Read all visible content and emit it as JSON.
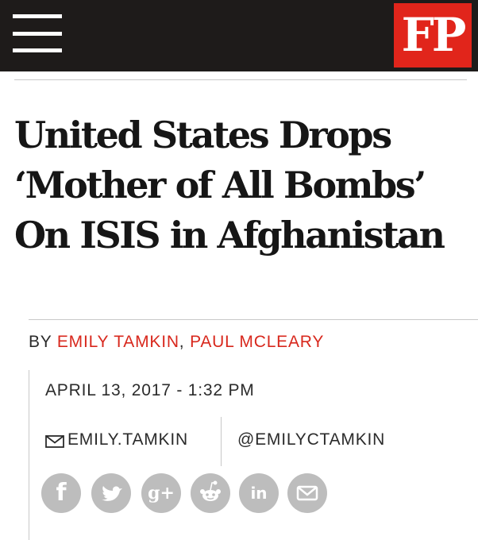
{
  "header": {
    "menu_icon": "hamburger-menu-icon",
    "logo_text": "FP",
    "brand_color": "#e1251b",
    "bar_color": "#1e1b1a"
  },
  "article": {
    "title": "United States Drops ‘Mother of All Bombs’ On ISIS in Afghanistan",
    "byline_prefix": "BY",
    "authors": [
      "EMILY TAMKIN",
      "PAUL MCLEARY"
    ],
    "author_separator": ",",
    "author_color": "#d8281d",
    "date": "APRIL 13, 2017 - 1:32 PM"
  },
  "contact": {
    "email_icon": "envelope-icon",
    "email_label": "EMILY.TAMKIN",
    "twitter_label": "@EMILYCTAMKIN"
  },
  "share": {
    "facebook_glyph": "f",
    "googleplus_glyph": "g+",
    "linkedin_glyph": "in",
    "icons": [
      "facebook-icon",
      "twitter-icon",
      "google-plus-icon",
      "reddit-icon",
      "linkedin-icon",
      "email-icon"
    ],
    "icon_color": "#bdbdbd"
  }
}
